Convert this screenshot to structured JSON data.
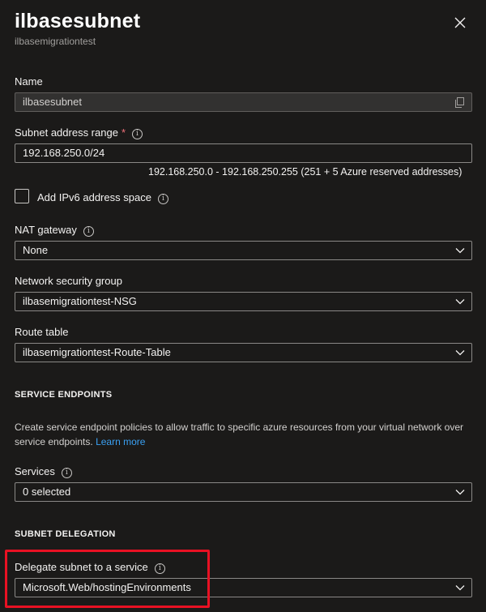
{
  "header": {
    "title": "ilbasesubnet",
    "subtitle": "ilbasemigrationtest"
  },
  "name_field": {
    "label": "Name",
    "value": "ilbasesubnet"
  },
  "address_range": {
    "label": "Subnet address range",
    "required_mark": "*",
    "value": "192.168.250.0/24",
    "hint": "192.168.250.0 - 192.168.250.255 (251 + 5 Azure reserved addresses)"
  },
  "ipv6": {
    "label": "Add IPv6 address space",
    "checked": false
  },
  "nat_gateway": {
    "label": "NAT gateway",
    "value": "None"
  },
  "nsg": {
    "label": "Network security group",
    "value": "ilbasemigrationtest-NSG"
  },
  "route_table": {
    "label": "Route table",
    "value": "ilbasemigrationtest-Route-Table"
  },
  "service_endpoints": {
    "heading": "SERVICE ENDPOINTS",
    "description": "Create service endpoint policies to allow traffic to specific azure resources from your virtual network over service endpoints.",
    "learn_more": "Learn more",
    "services_label": "Services",
    "services_value": "0 selected"
  },
  "subnet_delegation": {
    "heading": "SUBNET DELEGATION",
    "label": "Delegate subnet to a service",
    "value": "Microsoft.Web/hostingEnvironments"
  },
  "colors": {
    "background": "#1b1a19",
    "highlight": "#e81123",
    "link": "#3aa0f3",
    "required": "#f1707b"
  },
  "icons": [
    "close-icon",
    "copy-icon",
    "info-icon",
    "chevron-down-icon"
  ]
}
